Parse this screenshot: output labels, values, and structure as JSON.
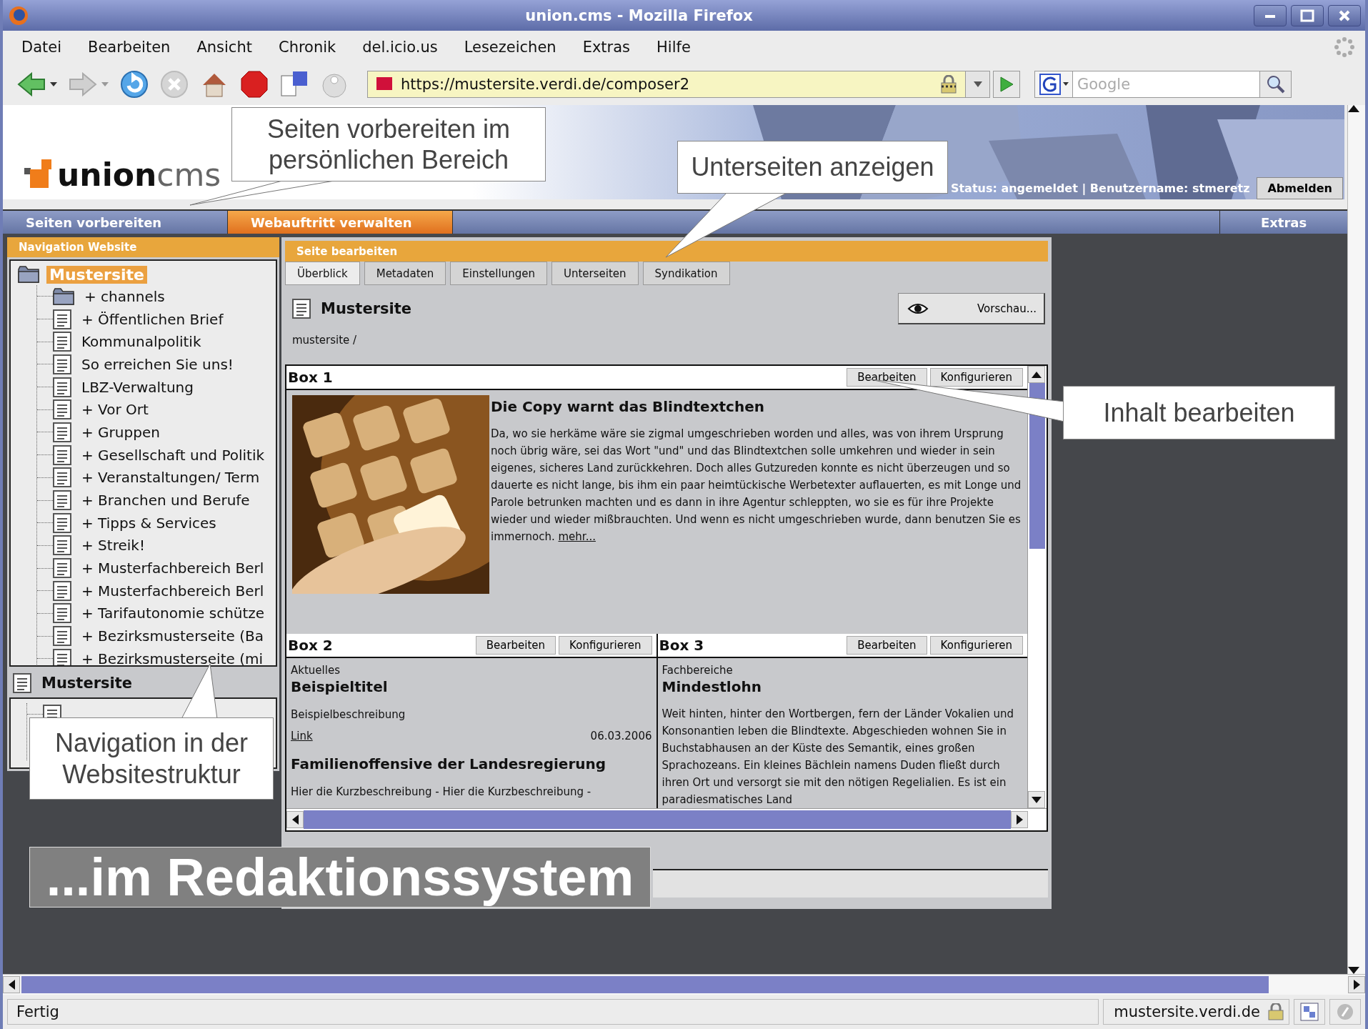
{
  "window": {
    "title": "union.cms - Mozilla Firefox"
  },
  "menu": [
    {
      "label": "Datei"
    },
    {
      "label": "Bearbeiten"
    },
    {
      "label": "Ansicht"
    },
    {
      "label": "Chronik"
    },
    {
      "label": "del.icio.us"
    },
    {
      "label": "Lesezeichen"
    },
    {
      "label": "Extras"
    },
    {
      "label": "Hilfe"
    }
  ],
  "toolbar": {
    "url": "https://mustersite.verdi.de/composer2",
    "search": {
      "placeholder": "Google"
    }
  },
  "header": {
    "logo": {
      "first": "union",
      "second": "cms"
    },
    "user_status": "Status: angemeldet | Benutzername: stmeretz",
    "logout_button": "Abmelden"
  },
  "main_tabs": [
    {
      "label": "Seiten vorbereiten",
      "selected": false
    },
    {
      "label": "Webauftritt verwalten",
      "selected": true
    }
  ],
  "extras_tab": "Extras",
  "sidebar": {
    "title": "Navigation Website",
    "tree": {
      "label": "Mustersite",
      "selected": true,
      "kind": "folder",
      "children": [
        {
          "label": "+ channels",
          "kind": "folder",
          "selected": false
        },
        {
          "label": "+ Öffentlichen Brief",
          "kind": "page",
          "selected": false
        },
        {
          "label": "Kommunalpolitik",
          "kind": "page",
          "selected": false
        },
        {
          "label": "So erreichen Sie uns!",
          "kind": "page",
          "selected": false
        },
        {
          "label": "LBZ-Verwaltung",
          "kind": "page",
          "selected": false
        },
        {
          "label": "+ Vor Ort",
          "kind": "page",
          "selected": false
        },
        {
          "label": "+ Gruppen",
          "kind": "page",
          "selected": false
        },
        {
          "label": "+ Gesellschaft und Politik",
          "kind": "page",
          "selected": false
        },
        {
          "label": "+ Veranstaltungen/ Term",
          "kind": "page",
          "selected": false
        },
        {
          "label": "+ Branchen und Berufe",
          "kind": "page",
          "selected": false
        },
        {
          "label": "+ Tipps & Services",
          "kind": "page",
          "selected": false
        },
        {
          "label": "+ Streik!",
          "kind": "page",
          "selected": false
        },
        {
          "label": "+ Musterfachbereich Berl",
          "kind": "page",
          "selected": false
        },
        {
          "label": "+ Musterfachbereich Berl",
          "kind": "page",
          "selected": false
        },
        {
          "label": "+ Tarifautonomie schütze",
          "kind": "page",
          "selected": false
        },
        {
          "label": "+ Bezirksmusterseite (Ba",
          "kind": "page",
          "selected": false
        },
        {
          "label": "+ Bezirksmusterseite (mi",
          "kind": "page",
          "selected": false
        }
      ]
    },
    "detail": {
      "title": "Mustersite"
    }
  },
  "editor": {
    "title": "Seite bearbeiten",
    "tabs": [
      {
        "label": "Überblick",
        "selected": true
      },
      {
        "label": "Metadaten",
        "selected": false
      },
      {
        "label": "Einstellungen",
        "selected": false
      },
      {
        "label": "Unterseiten",
        "selected": false
      },
      {
        "label": "Syndikation",
        "selected": false
      }
    ],
    "page_title": "Mustersite",
    "preview_button": "Vorschau...",
    "breadcrumb": "mustersite /",
    "boxes": [
      {
        "title": "Box 1",
        "kind": "teaser",
        "buttons": [
          "Bearbeiten",
          "Konfigurieren"
        ],
        "headline": "Die Copy warnt das Blindtextchen",
        "text": "Da, wo sie herkäme wäre sie zigmal umgeschrieben worden und alles, was von ihrem Ursprung noch übrig wäre, sei das Wort \"und\" und das Blindtextchen solle umkehren und wieder in sein eigenes, sicheres Land zurückkehren. Doch alles Gutzureden konnte es nicht überzeugen und so dauerte es nicht lange, bis ihm ein paar heimtückische Werbetexter auflauerten, es mit Longe und Parole betrunken machten und es dann in ihre Agentur schleppten, wo sie es für ihre Projekte wieder und wieder mißbrauchten. Und wenn es nicht umgeschrieben wurde, dann benutzen Sie es immernoch.",
        "more_link": "mehr..."
      },
      {
        "title": "Box 2",
        "kind": "news",
        "buttons": [
          "Bearbeiten",
          "Konfigurieren"
        ],
        "category": "Aktuelles",
        "items": [
          {
            "headline": "Beispieltitel",
            "description": "Beispielbeschreibung",
            "link": "Link",
            "date": "06.03.2006"
          },
          {
            "headline": "Familienoffensive der Landesregierung",
            "description": "Hier die Kurzbeschreibung - Hier die Kurzbeschreibung -"
          }
        ]
      },
      {
        "title": "Box 3",
        "kind": "article",
        "buttons": [
          "Bearbeiten",
          "Konfigurieren"
        ],
        "category": "Fachbereiche",
        "headline": "Mindestlohn",
        "text": "Weit hinten, hinter den Wortbergen, fern der Länder Vokalien und Konsonantien leben die Blindtexte. Abgeschieden wohnen Sie in Buchstabhausen an der Küste des Semantik, eines großen Sprachozeans. Ein kleines Bächlein namens Duden fließt durch ihren Ort und versorgt sie mit den nötigen Regelialien. Es ist ein paradiesmatisches Land"
      }
    ]
  },
  "callouts": [
    {
      "text": "Seiten vorbereiten im persönlichen Bereich",
      "kind": "note"
    },
    {
      "text": "Unterseiten anzeigen",
      "kind": "note"
    },
    {
      "text": "Inhalt bearbeiten",
      "kind": "note"
    },
    {
      "text": "Navigation in der Websitestruktur",
      "kind": "note"
    },
    {
      "text": "...im Redaktionssystem",
      "kind": "banner"
    }
  ],
  "status_bar": {
    "text": "Fertig",
    "host": "mustersite.verdi.de"
  }
}
